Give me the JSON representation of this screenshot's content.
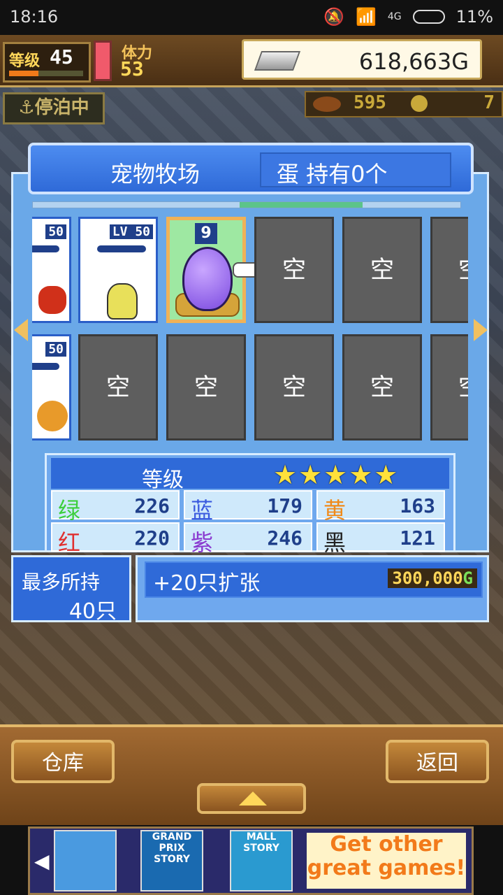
{
  "status_bar": {
    "time": "18:16",
    "network": "4G",
    "battery": "11%"
  },
  "hud": {
    "level_label": "等级",
    "level": "45",
    "stamina_label": "体力",
    "stamina": "53",
    "gold": "618,663G",
    "docked": "停泊中",
    "resource_a": "595",
    "resource_b": "7"
  },
  "panel": {
    "title": "宠物牧场",
    "egg_status": "蛋 持有0个",
    "slots_row1": [
      {
        "type": "pet",
        "level": "50"
      },
      {
        "type": "pet",
        "level": "LV 50"
      },
      {
        "type": "egg",
        "count": "9"
      },
      {
        "type": "empty",
        "label": "空"
      },
      {
        "type": "empty",
        "label": "空"
      },
      {
        "type": "empty",
        "label": "空"
      }
    ],
    "slots_row2": [
      {
        "type": "pet",
        "level": "50"
      },
      {
        "type": "empty",
        "label": "空"
      },
      {
        "type": "empty",
        "label": "空"
      },
      {
        "type": "empty",
        "label": "空"
      },
      {
        "type": "empty",
        "label": "空"
      },
      {
        "type": "empty",
        "label": "空"
      }
    ],
    "grade_label": "等级",
    "grade_stars": 5,
    "stats": [
      {
        "name": "绿",
        "value": "226",
        "color": "#3ccf3c"
      },
      {
        "name": "蓝",
        "value": "179",
        "color": "#3a5adf"
      },
      {
        "name": "黄",
        "value": "163",
        "color": "#f08a1a"
      },
      {
        "name": "红",
        "value": "220",
        "color": "#e03030"
      },
      {
        "name": "紫",
        "value": "246",
        "color": "#8a3ad0"
      },
      {
        "name": "黑",
        "value": "121",
        "color": "#222222"
      }
    ],
    "max_label": "最多所持",
    "max_value": "40只",
    "expand_label": "+20只扩张",
    "expand_price": "300,000",
    "expand_price_unit": "G"
  },
  "bottom": {
    "warehouse": "仓库",
    "back": "返回"
  },
  "ad": {
    "game1": "GRAND PRIX STORY",
    "game2": "MALL STORY",
    "cta": "Get other great games!"
  }
}
